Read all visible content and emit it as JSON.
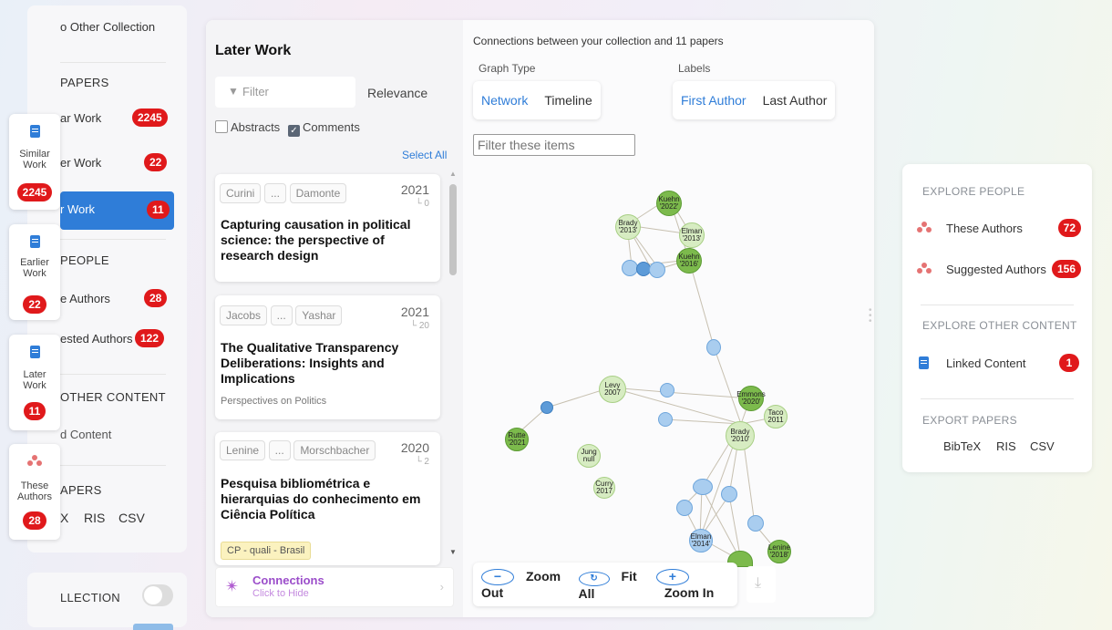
{
  "left_sidebar": {
    "add_to_other": "o Other Collection",
    "papers_heading": "PAPERS",
    "items": [
      {
        "label": "ar Work",
        "count": "2245"
      },
      {
        "label": "er Work",
        "count": "22"
      },
      {
        "label": "r Work",
        "count": "11"
      }
    ],
    "people_heading": "PEOPLE",
    "people_items": [
      {
        "label": "e Authors",
        "count": "28"
      },
      {
        "label": "ested Authors",
        "count": "122"
      }
    ],
    "other_heading": "OTHER CONTENT",
    "other_item": "d Content",
    "export_heading": "APERS",
    "export_items": [
      "X",
      "RIS",
      "CSV"
    ],
    "collection_label": "LLECTION"
  },
  "rail": [
    {
      "label1": "Similar",
      "label2": "Work",
      "count": "2245"
    },
    {
      "label1": "Earlier",
      "label2": "Work",
      "count": "22"
    },
    {
      "label1": "Later",
      "label2": "Work",
      "count": "11"
    },
    {
      "label1": "These",
      "label2": "Authors",
      "count": "28"
    }
  ],
  "list_panel": {
    "title": "Later Work",
    "filter_placeholder": "Filter",
    "sort": "Relevance",
    "abstracts": "Abstracts",
    "comments": "Comments",
    "select_all": "Select All",
    "cards": [
      {
        "author1": "Curini",
        "ellipsis": "...",
        "author2": "Damonte",
        "year": "2021",
        "cites": "└ 0",
        "title": "Capturing causation in political science: the perspective of research design",
        "journal": "",
        "tag": ""
      },
      {
        "author1": "Jacobs",
        "ellipsis": "...",
        "author2": "Yashar",
        "year": "2021",
        "cites": "└ 20",
        "title": "The Qualitative Transparency Deliberations: Insights and Implications",
        "journal": "Perspectives on Politics",
        "tag": ""
      },
      {
        "author1": "Lenine",
        "ellipsis": "...",
        "author2": "Morschbacher",
        "year": "2020",
        "cites": "└ 2",
        "title": "Pesquisa bibliométrica e hierarquias do conhecimento em Ciência Política",
        "journal": "",
        "tag": "CP - quali - Brasil"
      }
    ],
    "connections_label": "Connections",
    "connections_sub": "Click to Hide"
  },
  "graph_panel": {
    "heading": "Connections between your collection and 11 papers",
    "graph_type_label": "Graph Type",
    "graph_types": [
      "Network",
      "Timeline"
    ],
    "labels_label": "Labels",
    "label_options": [
      "First Author",
      "Last Author"
    ],
    "filter_placeholder": "Filter these items",
    "zoom_out": "Zoom Out",
    "fit_all": "Fit All",
    "zoom_in": "Zoom In",
    "nodes": [
      {
        "t": "Kuehn\n'2022'"
      },
      {
        "t": "Brady\n'2013'"
      },
      {
        "t": "Elman\n'2013'"
      },
      {
        "t": "Kuehn\n'2016'"
      },
      {
        "t": "Levy\n2007"
      },
      {
        "t": "Emmons\n'2020'"
      },
      {
        "t": "Taco\n2011"
      },
      {
        "t": "Brady\n'2010'"
      },
      {
        "t": "Rutte\n'2021"
      },
      {
        "t": "Jung\nnull"
      },
      {
        "t": "Curry\n2017"
      },
      {
        "t": "Elman\n'2014'"
      },
      {
        "t": "Lenine\n'2018'"
      }
    ]
  },
  "right_panel": {
    "explore_people": "EXPLORE PEOPLE",
    "these_authors": "These Authors",
    "these_authors_count": "72",
    "suggested_authors": "Suggested Authors",
    "suggested_authors_count": "156",
    "explore_other": "EXPLORE OTHER CONTENT",
    "linked_content": "Linked Content",
    "linked_content_count": "1",
    "export_papers": "EXPORT PAPERS",
    "export_formats": [
      "BibTeX",
      "RIS",
      "CSV"
    ]
  }
}
